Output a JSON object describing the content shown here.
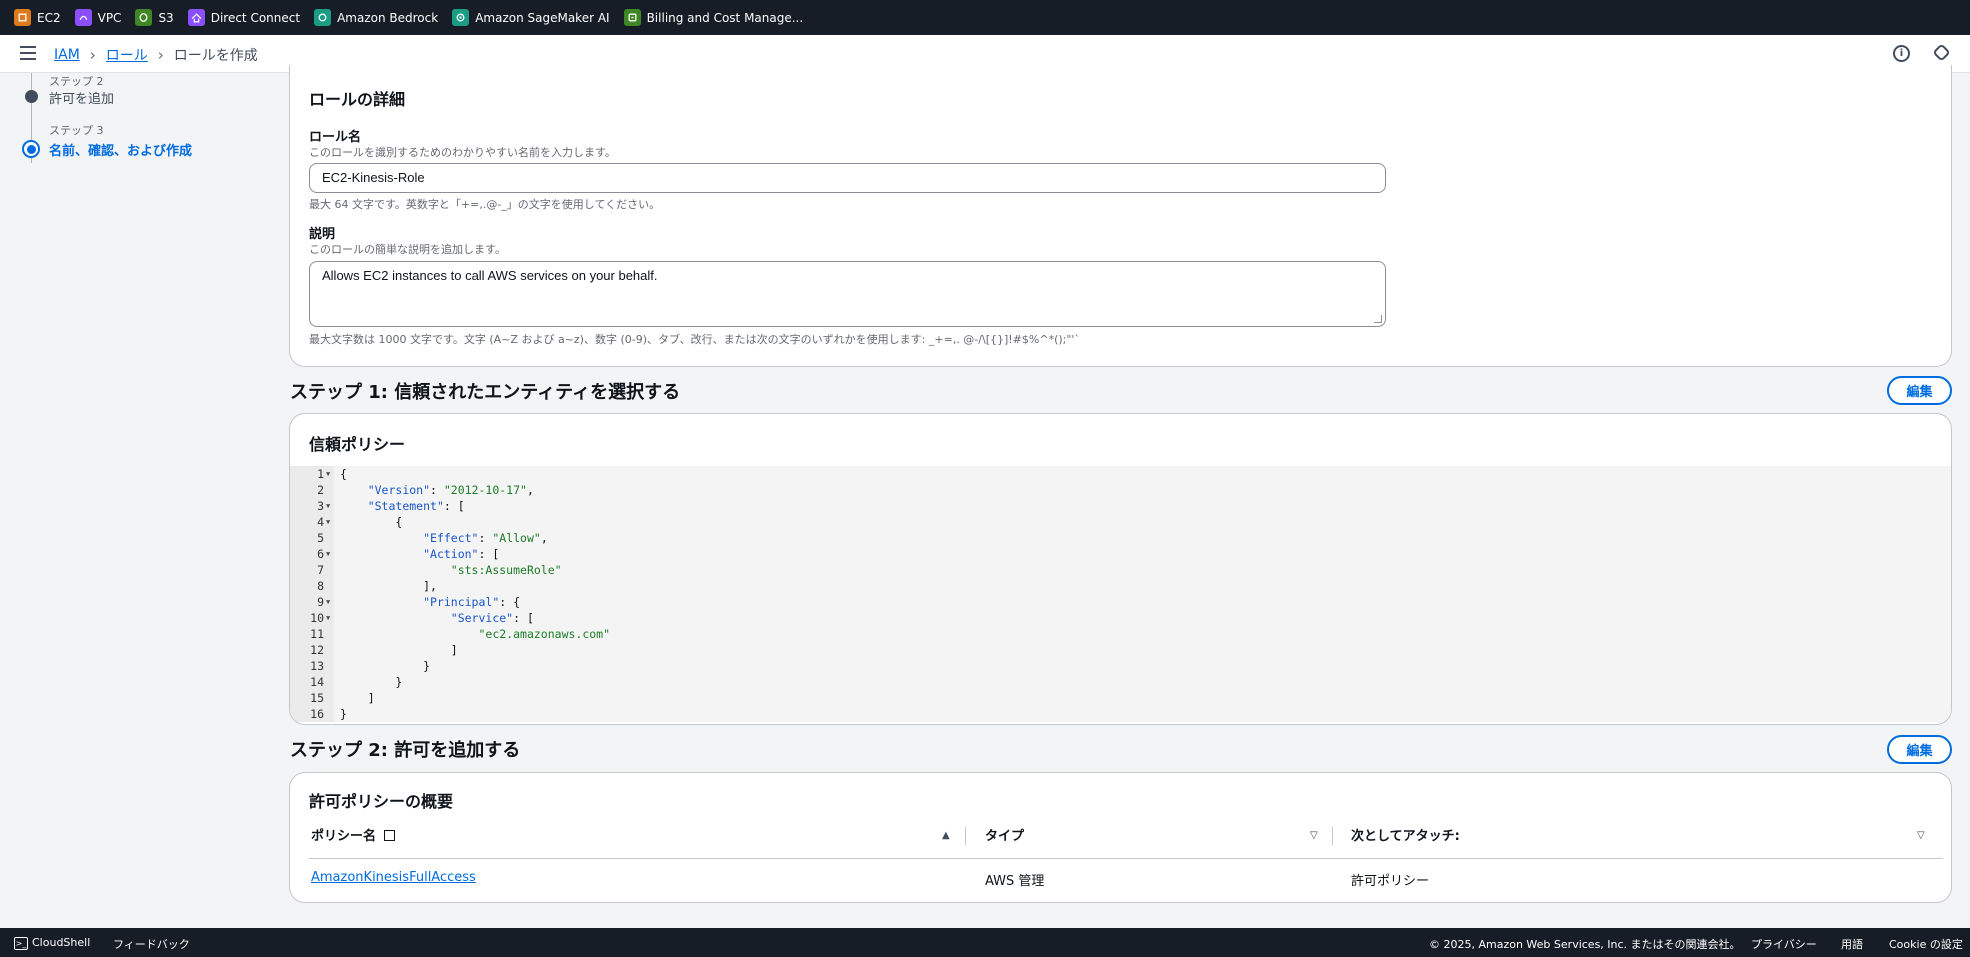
{
  "favorites": [
    {
      "label": "EC2",
      "color": "#e07b1b"
    },
    {
      "label": "VPC",
      "color": "#8c4fff"
    },
    {
      "label": "S3",
      "color": "#3f8624"
    },
    {
      "label": "Direct Connect",
      "color": "#8c4fff"
    },
    {
      "label": "Amazon Bedrock",
      "color": "#1b9c85"
    },
    {
      "label": "Amazon SageMaker AI",
      "color": "#1b9c85"
    },
    {
      "label": "Billing and Cost Manage...",
      "color": "#3f8624"
    }
  ],
  "breadcrumb": {
    "iam": "IAM",
    "roles": "ロール",
    "current": "ロールを作成"
  },
  "steps": {
    "step2_label": "ステップ 2",
    "step2_name": "許可を追加",
    "step3_label": "ステップ 3",
    "step3_name": "名前、確認、および作成"
  },
  "role_details": {
    "title": "ロールの詳細",
    "name_label": "ロール名",
    "name_desc": "このロールを識別するためのわかりやすい名前を入力します。",
    "name_value": "EC2-Kinesis-Role",
    "name_hint": "最大 64 文字です。英数字と「+=,.@-_」の文字を使用してください。",
    "desc_label": "説明",
    "desc_desc": "このロールの簡単な説明を追加します。",
    "desc_value": "Allows EC2 instances to call AWS services on your behalf.",
    "desc_hint": "最大文字数は 1000 文字です。文字 (A~Z および a~z)、数字 (0-9)、タブ、改行、または次の文字のいずれかを使用します: _+=,. @-/\\[{}]!#$%^*();\"'`"
  },
  "step1": {
    "heading": "ステップ 1: 信頼されたエンティティを選択する",
    "edit": "編集",
    "card_title": "信頼ポリシー",
    "code_lines": [
      "{",
      "    \"Version\": \"2012-10-17\",",
      "    \"Statement\": [",
      "        {",
      "            \"Effect\": \"Allow\",",
      "            \"Action\": [",
      "                \"sts:AssumeRole\"",
      "            ],",
      "            \"Principal\": {",
      "                \"Service\": [",
      "                    \"ec2.amazonaws.com\"",
      "                ]",
      "            }",
      "        }",
      "    ]",
      "}"
    ]
  },
  "step2": {
    "heading": "ステップ 2: 許可を追加する",
    "edit": "編集",
    "card_title": "許可ポリシーの概要",
    "columns": [
      "ポリシー名",
      "タイプ",
      "次としてアタッチ:"
    ],
    "rows": [
      {
        "policy": "AmazonKinesisFullAccess",
        "type": "AWS 管理",
        "attached_as": "許可ポリシー"
      }
    ]
  },
  "footer": {
    "cloudshell": "CloudShell",
    "feedback": "フィードバック",
    "copyright": "© 2025, Amazon Web Services, Inc. またはその関連会社。",
    "privacy": "プライバシー",
    "terms": "用語",
    "cookie": "Cookie の設定"
  }
}
